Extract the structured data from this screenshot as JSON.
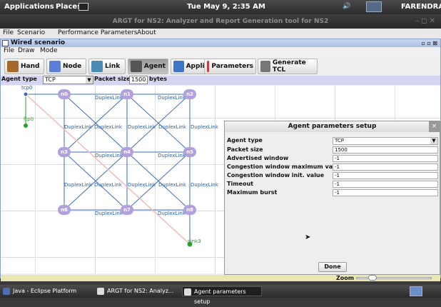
{
  "system_bar": {
    "applications": "Applications",
    "places": "Places",
    "datetime": "Tue May  9,  2:35 AM",
    "user": "FARENDRA"
  },
  "window": {
    "title": "ARGT for NS2: Analyzer and Report Generation tool for NS2",
    "controls": "–  ◻  ✕",
    "menu": [
      "File",
      "Scenario",
      "Performance Parameters",
      "About"
    ]
  },
  "inner_frame": {
    "title": "Wired scenario",
    "controls": "▫ ▫ ⊠",
    "menu": [
      "File",
      "Draw",
      "Mode"
    ]
  },
  "toolbar": {
    "buttons": [
      {
        "label": "Hand",
        "color": "#a36a2c"
      },
      {
        "label": "Node",
        "color": "#5b7fd6"
      },
      {
        "label": "Link",
        "color": "#4a8ab5"
      },
      {
        "label": "Agent",
        "color": "#555555"
      },
      {
        "label": "Application",
        "color": "#3c76c4"
      },
      {
        "label": "Parameters",
        "color": "#c43c3c"
      },
      {
        "label": "Generate TCL",
        "color": "#777777"
      }
    ],
    "selected": "Agent"
  },
  "agent_bar": {
    "agent_type_label": "Agent type",
    "agent_type_value": "TCP",
    "packet_size_label": "Packet size",
    "packet_size_value": "1500",
    "bytes_label": "bytes"
  },
  "canvas": {
    "nodes": [
      "n0",
      "n1",
      "n2",
      "n3",
      "n4",
      "n5",
      "n6",
      "n7",
      "n8"
    ],
    "link_label": "DuplexLink",
    "agents": {
      "tcp": "tcp0",
      "ftp": "ftp0",
      "sink": "sink3"
    }
  },
  "dialog": {
    "title": "Agent parameters setup",
    "close": "×",
    "rows": [
      {
        "label": "Agent type",
        "value": "TCP"
      },
      {
        "label": "Packet size",
        "value": "1500"
      },
      {
        "label": "Advertised window",
        "value": "-1"
      },
      {
        "label": "Congestion window maximum value",
        "value": "-1"
      },
      {
        "label": "Congestion window init. value",
        "value": "-1"
      },
      {
        "label": "Timeout",
        "value": "-1"
      },
      {
        "label": "Maximum burst",
        "value": "-1"
      }
    ],
    "done": "Done"
  },
  "zoom": {
    "label": "Zoom"
  },
  "taskbar": {
    "items": [
      "Java - Eclipse Platform",
      "ARGT for NS2: Analyz...",
      "Agent parameters setup"
    ],
    "active": "Agent parameters setup"
  }
}
